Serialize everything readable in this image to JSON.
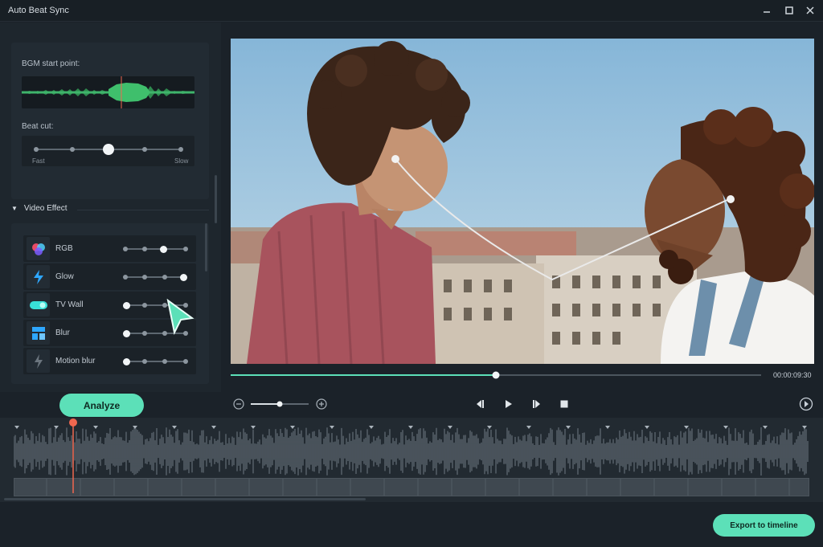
{
  "window": {
    "title": "Auto Beat Sync"
  },
  "bgm": {
    "label": "BGM start point:"
  },
  "beat_cut": {
    "label": "Beat cut:",
    "min_label": "Fast",
    "max_label": "Slow",
    "value_step": 3,
    "steps": 5
  },
  "video_effect": {
    "section_label": "Video Effect",
    "items": [
      {
        "name": "RGB",
        "icon": "rgb-icon",
        "level_step": 3
      },
      {
        "name": "Glow",
        "icon": "glow-icon",
        "level_step": 4
      },
      {
        "name": "TV Wall",
        "icon": "tv-wall-icon",
        "level_step": 1
      },
      {
        "name": "Blur",
        "icon": "blur-icon",
        "level_step": 1
      },
      {
        "name": "Motion blur",
        "icon": "motion-blur-icon",
        "level_step": 1
      }
    ]
  },
  "player": {
    "timecode": "00:00:09:30",
    "progress": 0.5,
    "zoom": 0.5
  },
  "buttons": {
    "analyze": "Analyze",
    "export": "Export to timeline"
  },
  "colors": {
    "accent": "#5ce0b8",
    "playhead": "#f0674f"
  }
}
